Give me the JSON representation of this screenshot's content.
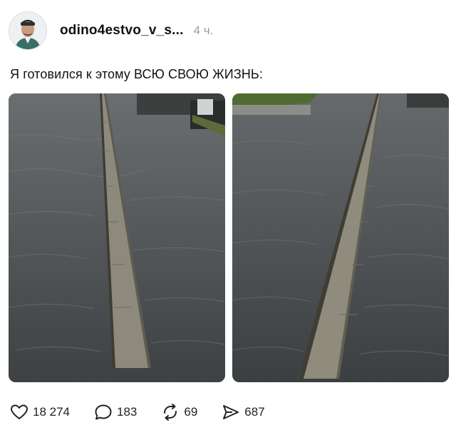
{
  "post": {
    "author": "odino4estvo_v_s...",
    "time": "4 ч.",
    "text": "Я готовился к этому ВСЮ СВОЮ ЖИЗНЬ:"
  },
  "images": [
    {
      "alt": "flooded-walkway-with-curb-1"
    },
    {
      "alt": "flooded-walkway-with-curb-2"
    }
  ],
  "actions": {
    "likes": "18 274",
    "comments": "183",
    "reposts": "69",
    "shares": "687"
  },
  "icons": {
    "like": "heart-icon",
    "comment": "comment-bubble-icon",
    "repost": "repost-arrows-icon",
    "share": "share-arrow-icon"
  }
}
